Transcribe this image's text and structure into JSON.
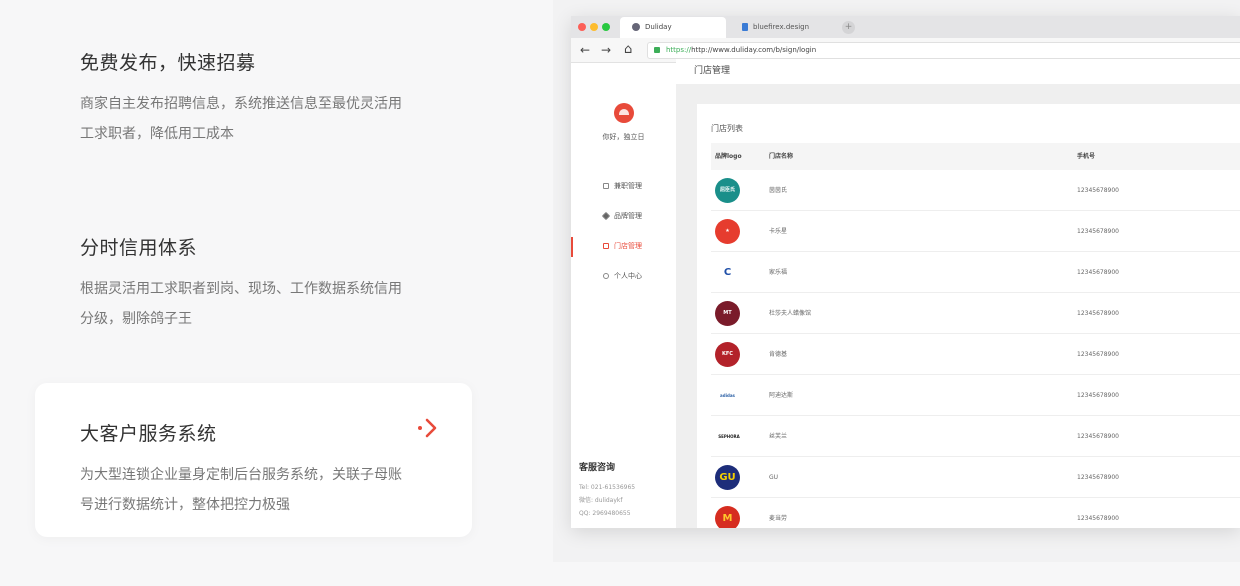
{
  "features": [
    {
      "title": "免费发布，快速招募",
      "desc": "商家自主发布招聘信息，系统推送信息至最优灵活用工求职者，降低用工成本"
    },
    {
      "title": "分时信用体系",
      "desc": "根据灵活用工求职者到岗、现场、工作数据系统信用分级，剔除鸽子王"
    },
    {
      "title": "大客户服务系统",
      "desc": "为大型连锁企业量身定制后台服务系统，关联子母账号进行数据统计，整体把控力极强",
      "arrow_icon": "chevron-right-icon",
      "accent": "#e84a3a"
    }
  ],
  "browser": {
    "tabs": [
      {
        "label": "Duliday",
        "icon": "globe-icon"
      },
      {
        "label": "bluefirex.design",
        "icon": "page-icon"
      }
    ],
    "new_tab_label": "+",
    "nav": {
      "back": "←",
      "forward": "→",
      "home": "⌂"
    },
    "url_protocol": "https://",
    "url_rest": "http://www.duliday.com/b/sign/login"
  },
  "app": {
    "page_title": "门店管理",
    "greeting": "你好，独立日",
    "menu": [
      {
        "label": "兼职管理",
        "icon": "layers-icon",
        "active": false
      },
      {
        "label": "品牌管理",
        "icon": "tag-icon",
        "active": false
      },
      {
        "label": "门店管理",
        "icon": "store-icon",
        "active": true
      },
      {
        "label": "个人中心",
        "icon": "user-icon",
        "active": false
      }
    ],
    "contact": {
      "title": "客服咨询",
      "tel": "Tel: 021-61536965",
      "wechat": "微信: dulidaykf",
      "qq": "QQ: 2969480655"
    },
    "table": {
      "title": "门店列表",
      "headers": [
        "品牌logo",
        "门店名称",
        "手机号"
      ],
      "rows": [
        {
          "name": "茵茵氏",
          "phone": "12345678900",
          "logo_text": "屈臣氏",
          "logo_color": "#1a8f8a"
        },
        {
          "name": "卡乐星",
          "phone": "12345678900",
          "logo_text": "★",
          "logo_color": "#e63c2e"
        },
        {
          "name": "家乐福",
          "phone": "12345678900",
          "logo_text": "C",
          "logo_color": "#1f4fa8"
        },
        {
          "name": "杜莎夫人蜡像馆",
          "phone": "12345678900",
          "logo_text": "MT",
          "logo_color": "#7a1b2a"
        },
        {
          "name": "肯德基",
          "phone": "12345678900",
          "logo_text": "KFC",
          "logo_color": "#b3222a"
        },
        {
          "name": "阿迪达斯",
          "phone": "12345678900",
          "logo_text": "adidas",
          "logo_color": "#2a5fa5"
        },
        {
          "name": "丝芙兰",
          "phone": "12345678900",
          "logo_text": "SEPHORA",
          "logo_color": "#222222"
        },
        {
          "name": "GU",
          "phone": "12345678900",
          "logo_text": "GU",
          "logo_color": "#1d2d7a"
        },
        {
          "name": "麦当劳",
          "phone": "12345678900",
          "logo_text": "M",
          "logo_color": "#d62d20"
        }
      ]
    }
  }
}
